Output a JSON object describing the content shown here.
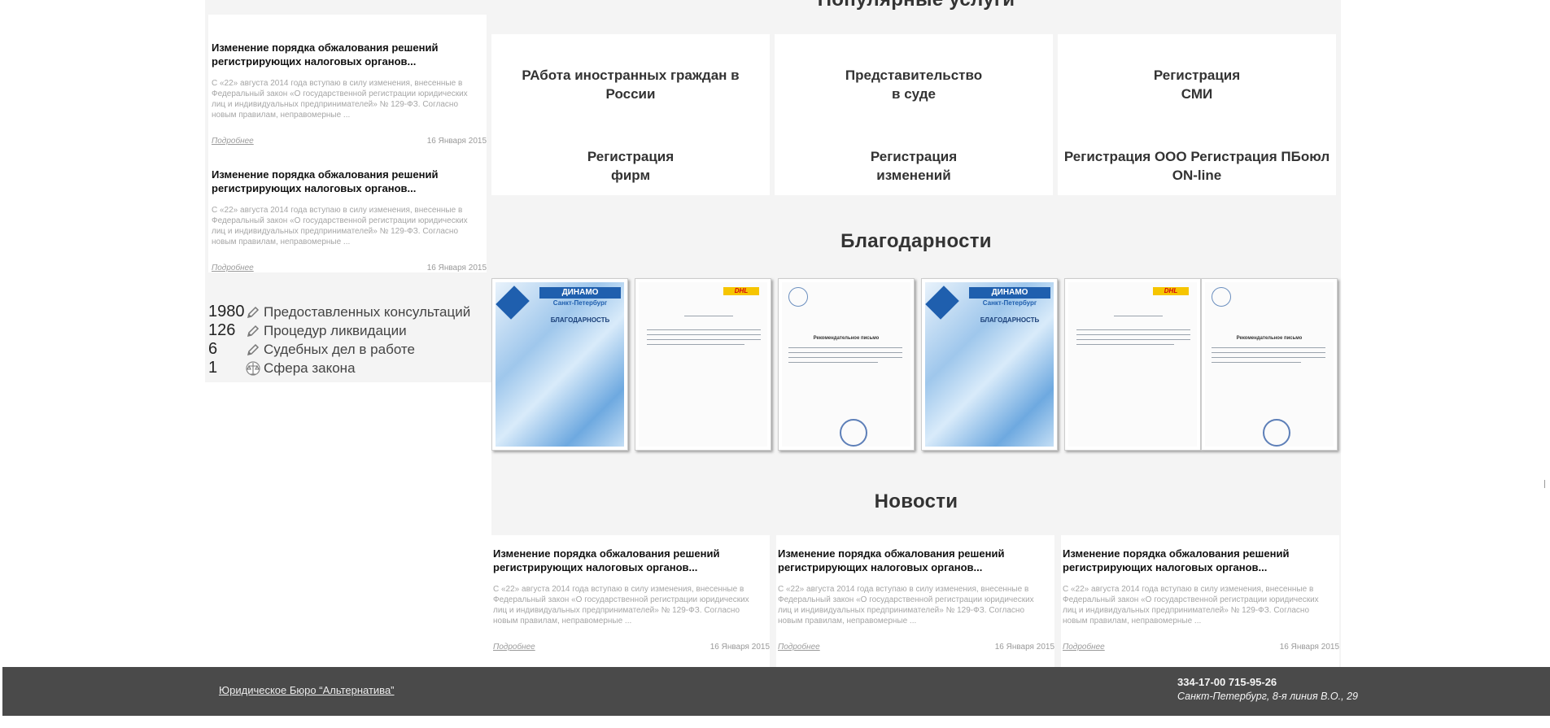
{
  "popular_services": {
    "title": "Популярные услуги",
    "items": [
      {
        "line1": "РАбота иностранных граждан в",
        "line2": "России"
      },
      {
        "line1": "Представительство",
        "line2": "в суде"
      },
      {
        "line1": "Регистрация",
        "line2": "СМИ"
      },
      {
        "line1": "Регистрация",
        "line2": "фирм"
      },
      {
        "line1": "Регистрация",
        "line2": "изменений"
      },
      {
        "line1": "Регистрация ООО Регистрация ПБоюл",
        "line2": "ON-line"
      }
    ]
  },
  "sidebar_news": [
    {
      "title_line1": "Изменение порядка обжалования решений",
      "title_line2": "регистрирующих налоговых органов...",
      "text_lines": [
        "С «22» августа 2014 года вступаю в силу изменения, внесенные в",
        "Федеральный закон «О государственной регистрации юридических",
        "лиц и индивидуальных предпринимателей» № 129-ФЗ. Согласно",
        "новым правилам, неправомерные ..."
      ],
      "more": "Подробнее",
      "date": "16 Января 2015"
    },
    {
      "title_line1": "Изменение порядка обжалования решений",
      "title_line2": "регистрирующих налоговых органов...",
      "text_lines": [
        "С «22» августа 2014 года вступаю в силу изменения, внесенные в",
        "Федеральный закон «О государственной регистрации юридических",
        "лиц и индивидуальных предпринимателей» № 129-ФЗ. Согласно",
        "новым правилам, неправомерные ..."
      ],
      "more": "Подробнее",
      "date": "16 Января 2015"
    }
  ],
  "stats": [
    {
      "number": "1980",
      "label": "Предоставленных консультаций",
      "icon": "pencil-icon"
    },
    {
      "number": "126",
      "label": "Процедур ликвидации",
      "icon": "pencil-icon"
    },
    {
      "number": "6",
      "label": "Судебных дел в работе",
      "icon": "pencil-icon"
    },
    {
      "number": "1",
      "label": "Сфера закона",
      "icon": "scales-icon"
    }
  ],
  "thanks": {
    "title": "Благодарности",
    "letters": [
      {
        "kind": "dinamo",
        "brand": "ДИНАМО",
        "city": "Санкт-Петербург",
        "heading": "БЛАГОДАРНОСТЬ"
      },
      {
        "kind": "dhl",
        "brand": "DHL"
      },
      {
        "kind": "fund",
        "heading": "Рекомендательное письмо"
      },
      {
        "kind": "dinamo",
        "brand": "ДИНАМО",
        "city": "Санкт-Петербург",
        "heading": "БЛАГОДАРНОСТЬ"
      },
      {
        "kind": "dhl",
        "brand": "DHL"
      },
      {
        "kind": "fund",
        "heading": "Рекомендательное письмо"
      }
    ]
  },
  "news": {
    "title": "Новости",
    "items": [
      {
        "title_line1": "Изменение порядка обжалования решений",
        "title_line2": "регистрирующих налоговых органов...",
        "text_lines": [
          "С «22» августа 2014 года вступаю в силу изменения, внесенные в",
          "Федеральный закон «О государственной регистрации юридических",
          "лиц и индивидуальных предпринимателей» № 129-ФЗ. Согласно",
          "новым правилам, неправомерные ..."
        ],
        "more": "Подробнее",
        "date": "16 Января 2015"
      },
      {
        "title_line1": "Изменение порядка обжалования решений",
        "title_line2": "регистрирующих налоговых органов...",
        "text_lines": [
          "С «22» августа 2014 года вступаю в силу изменения, внесенные в",
          "Федеральный закон «О государственной регистрации юридических",
          "лиц и индивидуальных предпринимателей» № 129-ФЗ. Согласно",
          "новым правилам, неправомерные ..."
        ],
        "more": "Подробнее",
        "date": "16 Января 2015"
      },
      {
        "title_line1": "Изменение порядка обжалования решений",
        "title_line2": "регистрирующих налоговых органов...",
        "text_lines": [
          "С «22» августа 2014 года вступаю в силу изменения, внесенные в",
          "Федеральный закон «О государственной регистрации юридических",
          "лиц и индивидуальных предпринимателей» № 129-ФЗ. Согласно",
          "новым правилам, неправомерные ..."
        ],
        "more": "Подробнее",
        "date": "16 Января 2015"
      }
    ]
  },
  "footer": {
    "company_link": "Юридическое Бюро “Альтернатива”",
    "phones": "334-17-00 715-95-26",
    "address": "Санкт-Петербург, 8-я линия В.О., 29"
  }
}
